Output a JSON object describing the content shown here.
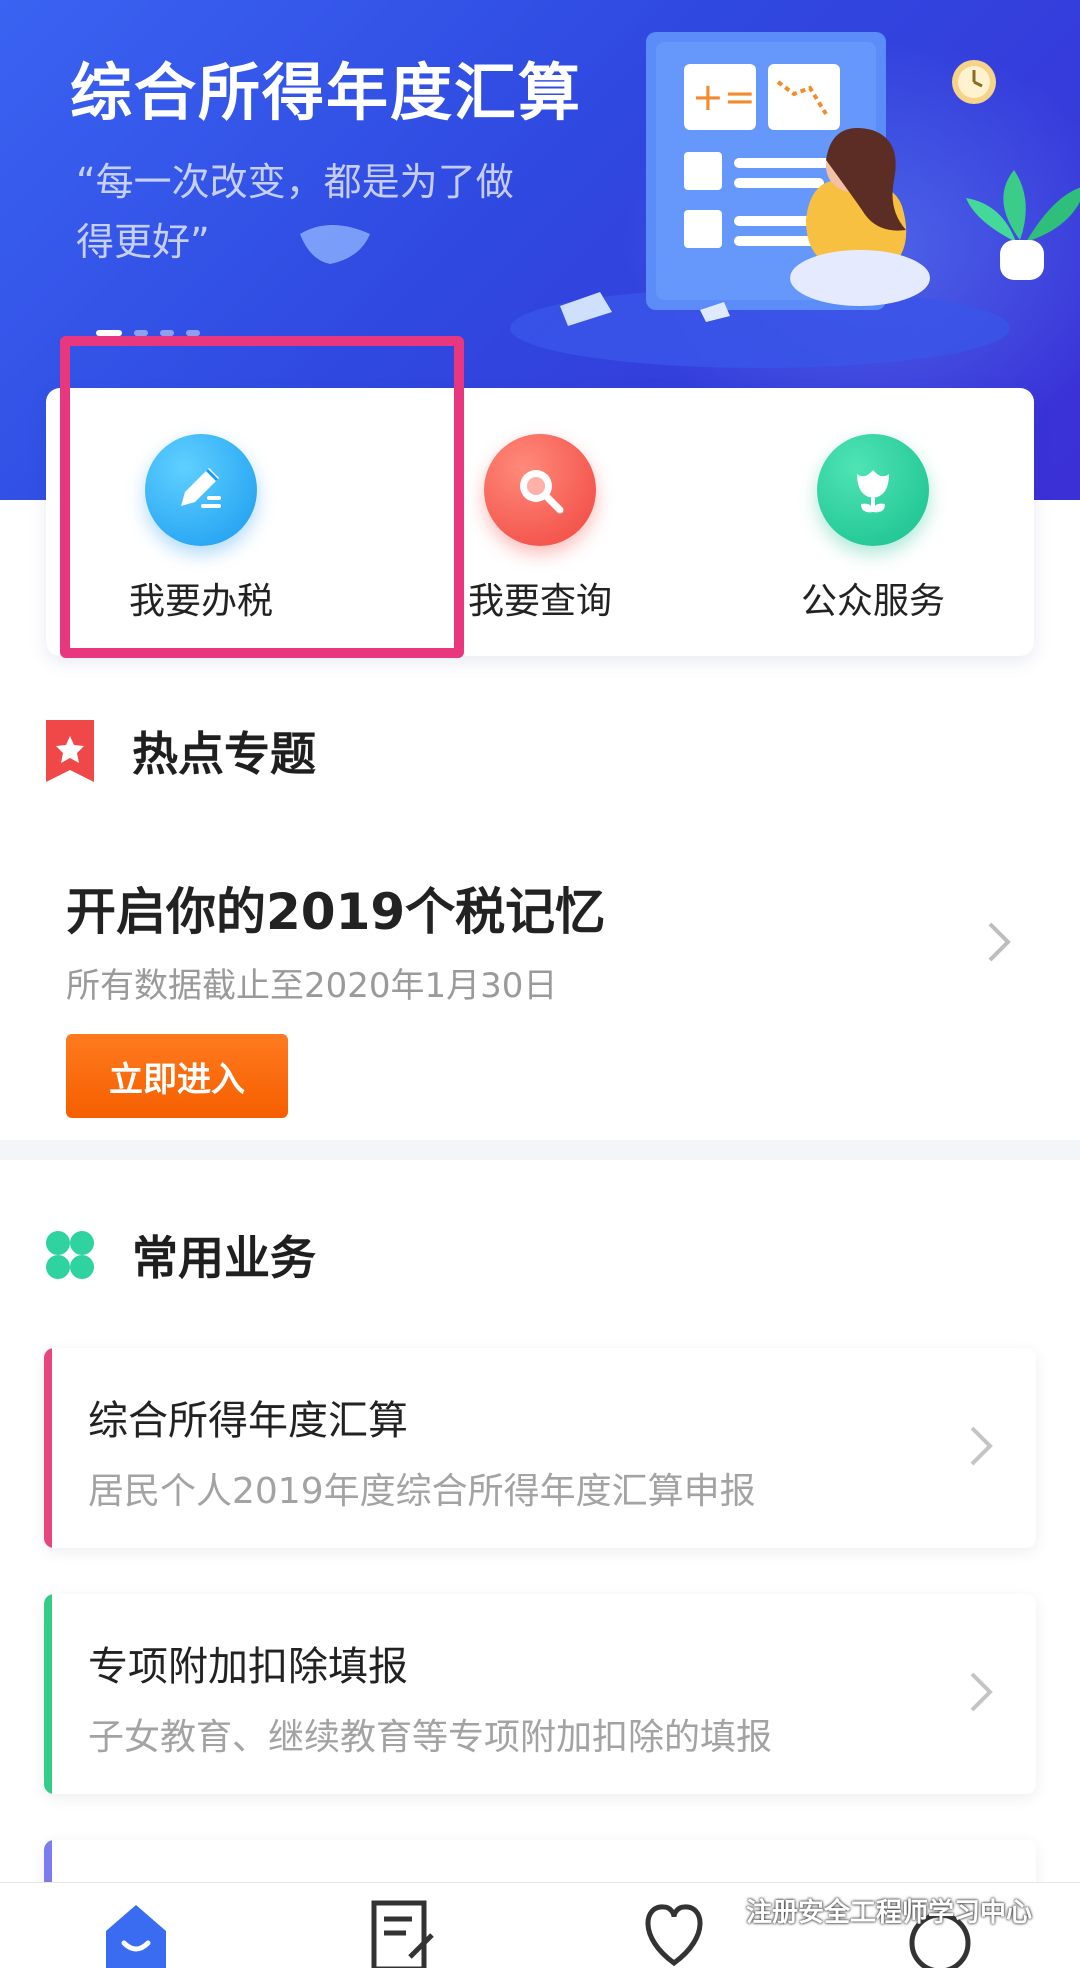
{
  "banner": {
    "title": "综合所得年度汇算",
    "quote": "“每一次改变，都是为了做得更好”"
  },
  "quick_actions": [
    {
      "label": "我要办税",
      "icon": "edit-pen-icon",
      "color": "#1a9af0"
    },
    {
      "label": "我要查询",
      "icon": "search-icon",
      "color": "#f0453f"
    },
    {
      "label": "公众服务",
      "icon": "tulip-flower-icon",
      "color": "#18bf8e"
    }
  ],
  "hot_topics": {
    "heading": "热点专题",
    "title": "开启你的2019个税记忆",
    "subtitle": "所有数据截止至2020年1月30日",
    "button": "立即进入",
    "button_color": "#f55f00"
  },
  "common_services": {
    "heading": "常用业务",
    "items": [
      {
        "title": "综合所得年度汇算",
        "desc": "居民个人2019年度综合所得年度汇算申报",
        "accent": "#e8457a"
      },
      {
        "title": "专项附加扣除填报",
        "desc": "子女教育、继续教育等专项附加扣除的填报",
        "accent": "#33cc88"
      }
    ]
  },
  "tabbar": {
    "tabs": [
      {
        "icon": "home-icon",
        "active": true
      },
      {
        "icon": "document-edit-icon",
        "active": false
      },
      {
        "icon": "heart-service-icon",
        "active": false
      },
      {
        "icon": "profile-icon",
        "active": false
      }
    ],
    "active_color": "#3a6cf2"
  },
  "watermark": "注册安全工程师学习中心",
  "highlight_color": "#e8377f"
}
